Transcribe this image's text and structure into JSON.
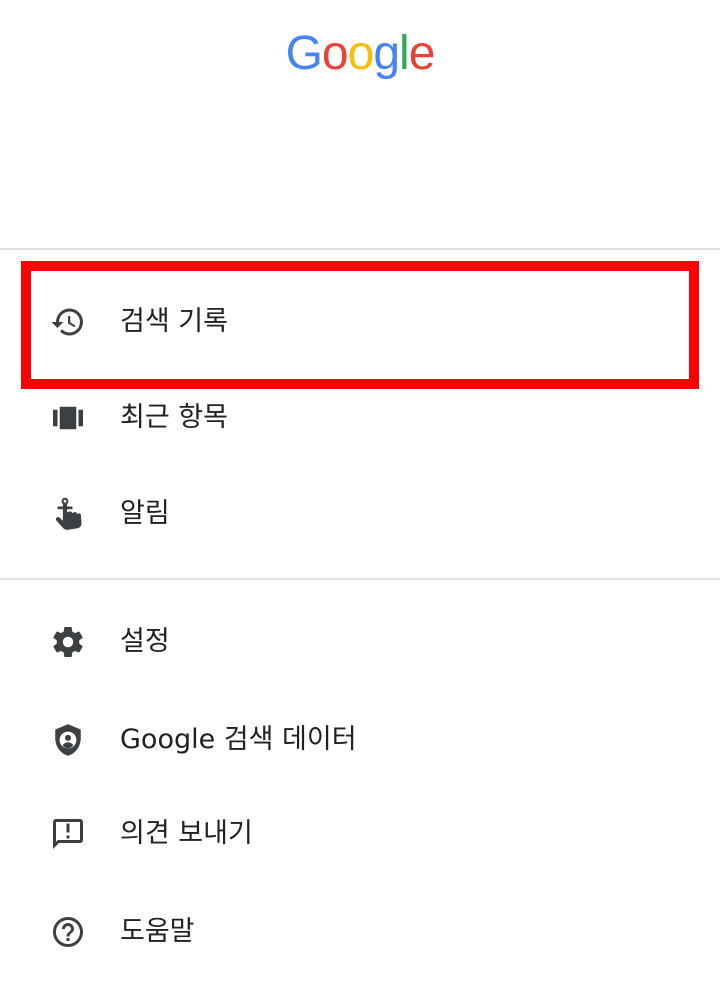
{
  "header": {
    "logo": {
      "letters": [
        "G",
        "o",
        "o",
        "g",
        "l",
        "e"
      ],
      "colors": [
        "#4285F4",
        "#EA4335",
        "#FBBC05",
        "#4285F4",
        "#34A853",
        "#EA4335"
      ]
    }
  },
  "menu": {
    "group1": [
      {
        "label": "검색 기록",
        "icon": "history-icon"
      },
      {
        "label": "최근 항목",
        "icon": "recent-items-icon"
      },
      {
        "label": "알림",
        "icon": "reminder-icon"
      }
    ],
    "group2": [
      {
        "label": "설정",
        "icon": "gear-icon"
      },
      {
        "label": "Google 검색 데이터",
        "icon": "shield-account-icon"
      },
      {
        "label": "의견 보내기",
        "icon": "feedback-icon"
      },
      {
        "label": "도움말",
        "icon": "help-icon"
      }
    ]
  },
  "highlight": {
    "target": "검색 기록",
    "color": "#FF0000"
  },
  "colors": {
    "icon": "#3c4043",
    "divider": "#e0e0e0"
  }
}
